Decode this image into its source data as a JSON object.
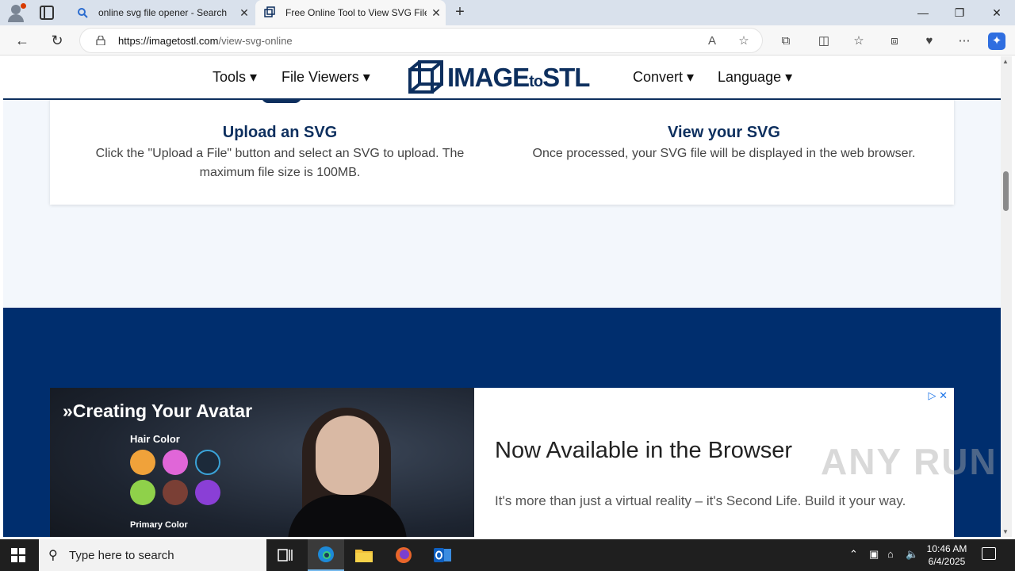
{
  "browser": {
    "tabs": [
      {
        "title": "online svg file opener - Search",
        "active": false
      },
      {
        "title": "Free Online Tool to View SVG File",
        "active": true
      }
    ],
    "address": {
      "domain": "https://imagetostl.com",
      "path": "/view-svg-online"
    }
  },
  "site": {
    "logo_text": "IMAGE",
    "logo_to": "to",
    "logo_stl": "STL",
    "nav": {
      "tools": "Tools ▾",
      "file_viewers": "File Viewers ▾",
      "convert": "Convert ▾",
      "language": "Language ▾"
    },
    "steps": [
      {
        "title": "Upload an SVG",
        "text": "Click the \"Upload a File\" button and select an SVG to upload. The maximum file size is 100MB."
      },
      {
        "title": "View your SVG",
        "text": "Once processed, your SVG file will be displayed in the web browser."
      }
    ]
  },
  "ad": {
    "headline": "»Creating Your Avatar",
    "hair_label": "Hair Color",
    "primary_label": "Primary Color",
    "swatches": [
      "#f0a23a",
      "#e066d8",
      "#1c2a3a",
      "#8fd14a",
      "#7a3f35",
      "#8a3fd6"
    ],
    "title": "Now Available in the Browser",
    "subtitle": "It's more than just a virtual reality – it's Second Life. Build it your way."
  },
  "watermark": "ANY RUN",
  "taskbar": {
    "search_placeholder": "Type here to search",
    "time": "10:46 AM",
    "date": "6/4/2025"
  },
  "colors": {
    "brand": "#0d2f5e",
    "band": "#002e6e"
  }
}
